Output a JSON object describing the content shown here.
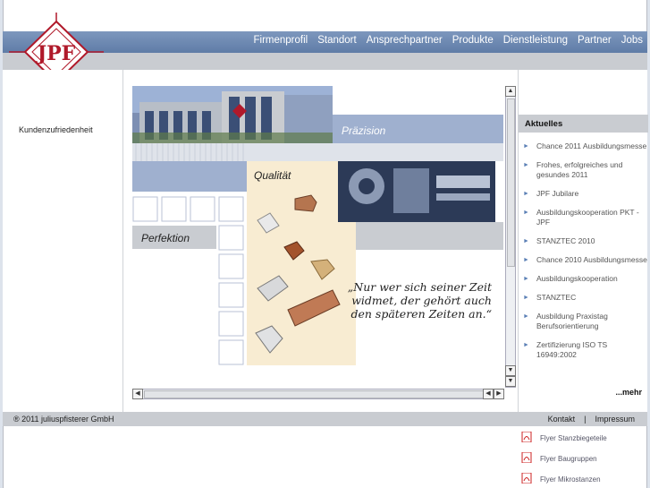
{
  "nav": {
    "items": [
      "Firmenprofil",
      "Standort",
      "Ansprechpartner",
      "Produkte",
      "Dienstleistung",
      "Partner",
      "Jobs"
    ]
  },
  "logo": {
    "text": "JPF",
    "color": "#b0192a"
  },
  "left": {
    "item": "Kundenzufriedenheit"
  },
  "stage": {
    "praezision": "Präzision",
    "qualitaet": "Qualität",
    "perfektion": "Perfektion",
    "quote_lines": [
      "„Nur wer sich seiner Zeit",
      "widmet, der gehört auch",
      "den späteren Zeiten an.“"
    ]
  },
  "sidebar": {
    "heading": "Aktuelles",
    "news": [
      "Chance 2011 Ausbildungsmesse",
      "Frohes, erfolgreiches und gesundes 2011",
      "JPF Jubilare",
      "Ausbildungskooperation PKT - JPF",
      "STANZTEC 2010",
      "Chance 2010 Ausbildungsmesse",
      "Ausbildungskooperation",
      "STANZTEC",
      "Ausbildung Praxistag Berufsorientierung",
      "Zertifizierung ISO TS 16949:2002"
    ],
    "more": "...mehr"
  },
  "footer": {
    "copyright": "® 2011 juliuspfisterer GmbH",
    "kontakt": "Kontakt",
    "separator": "|",
    "impressum": "Impressum"
  },
  "downloads": [
    "Flyer Stanzbiegeteile",
    "Flyer Baugruppen",
    "Flyer Mikrostanzen"
  ],
  "colors": {
    "nav_blue": "#6a86b0",
    "panel_blue": "#9fb0cf",
    "grey_bar": "#c9ccd1",
    "accent_red": "#b0192a"
  }
}
